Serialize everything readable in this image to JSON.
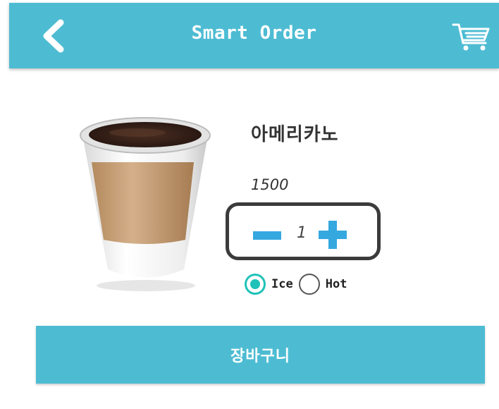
{
  "header": {
    "title": "Smart Order",
    "back_icon": "chevron-left-icon",
    "cart_icon": "shopping-cart-icon"
  },
  "product": {
    "image": "coffee-cup-image",
    "name": "아메리카노",
    "price": "1500",
    "quantity": "1",
    "minus_icon": "minus-icon",
    "plus_icon": "plus-icon"
  },
  "temperature": {
    "options": [
      {
        "label": "Ice",
        "selected": true
      },
      {
        "label": "Hot",
        "selected": false
      }
    ]
  },
  "actions": {
    "add_to_cart_label": "장바구니"
  },
  "colors": {
    "primary": "#4dbcd3",
    "accent_blue": "#35a8e0",
    "radio_selected": "#1fc2b8"
  }
}
